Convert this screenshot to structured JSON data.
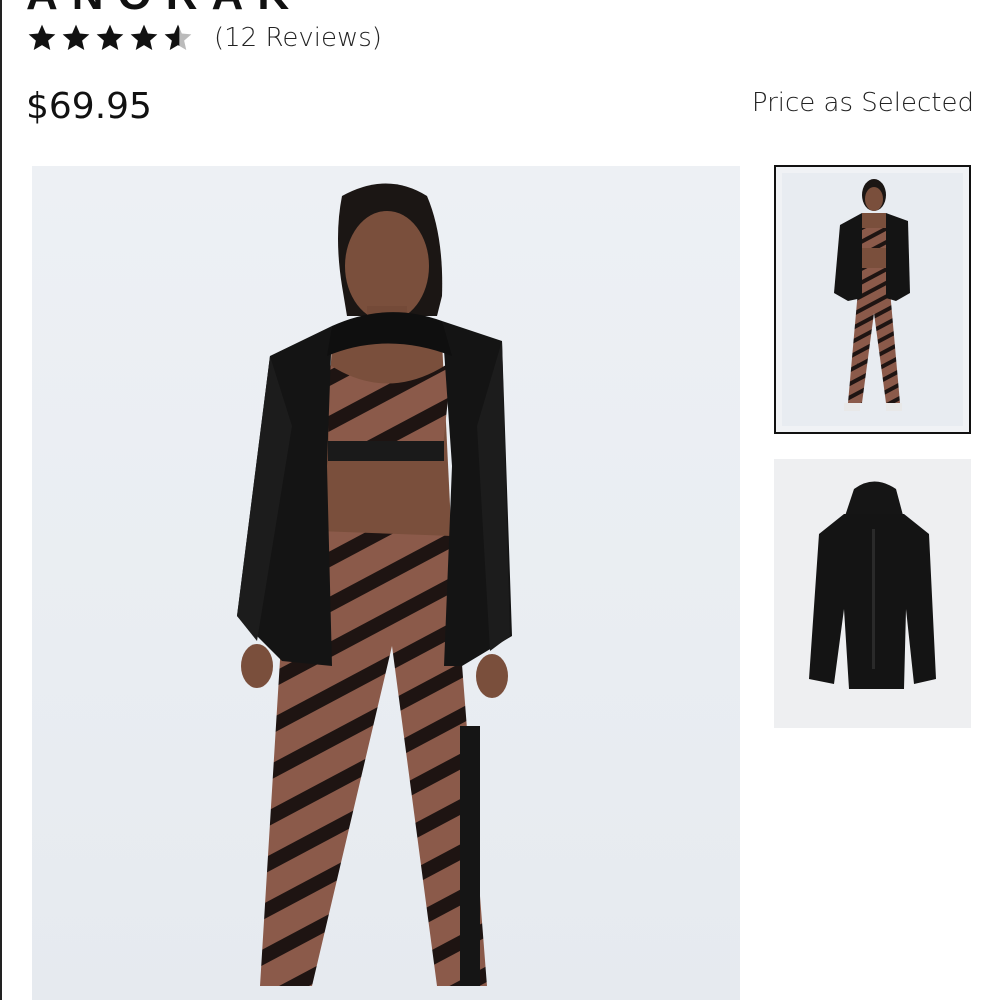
{
  "product": {
    "title_partial": "ANORAK",
    "rating": 4.5,
    "rating_max": 5,
    "reviews_label": "(12 Reviews)",
    "price": "$69.95",
    "price_note": "Price as Selected"
  },
  "gallery": {
    "main_image": "model-wearing-black-anorak-zebra-leggings",
    "thumbnails": [
      {
        "image": "model-full-length-thumbnail",
        "selected": true
      },
      {
        "image": "black-anorak-product-thumbnail",
        "selected": false
      }
    ]
  },
  "icons": {
    "star": "star-icon",
    "half_star": "half-star-icon"
  },
  "colors": {
    "text": "#1a1a1a",
    "jacket": "#141414",
    "zebra_base": "#8b5a4a",
    "zebra_stripe": "#1e1412",
    "background_photo": "#eceff3"
  }
}
